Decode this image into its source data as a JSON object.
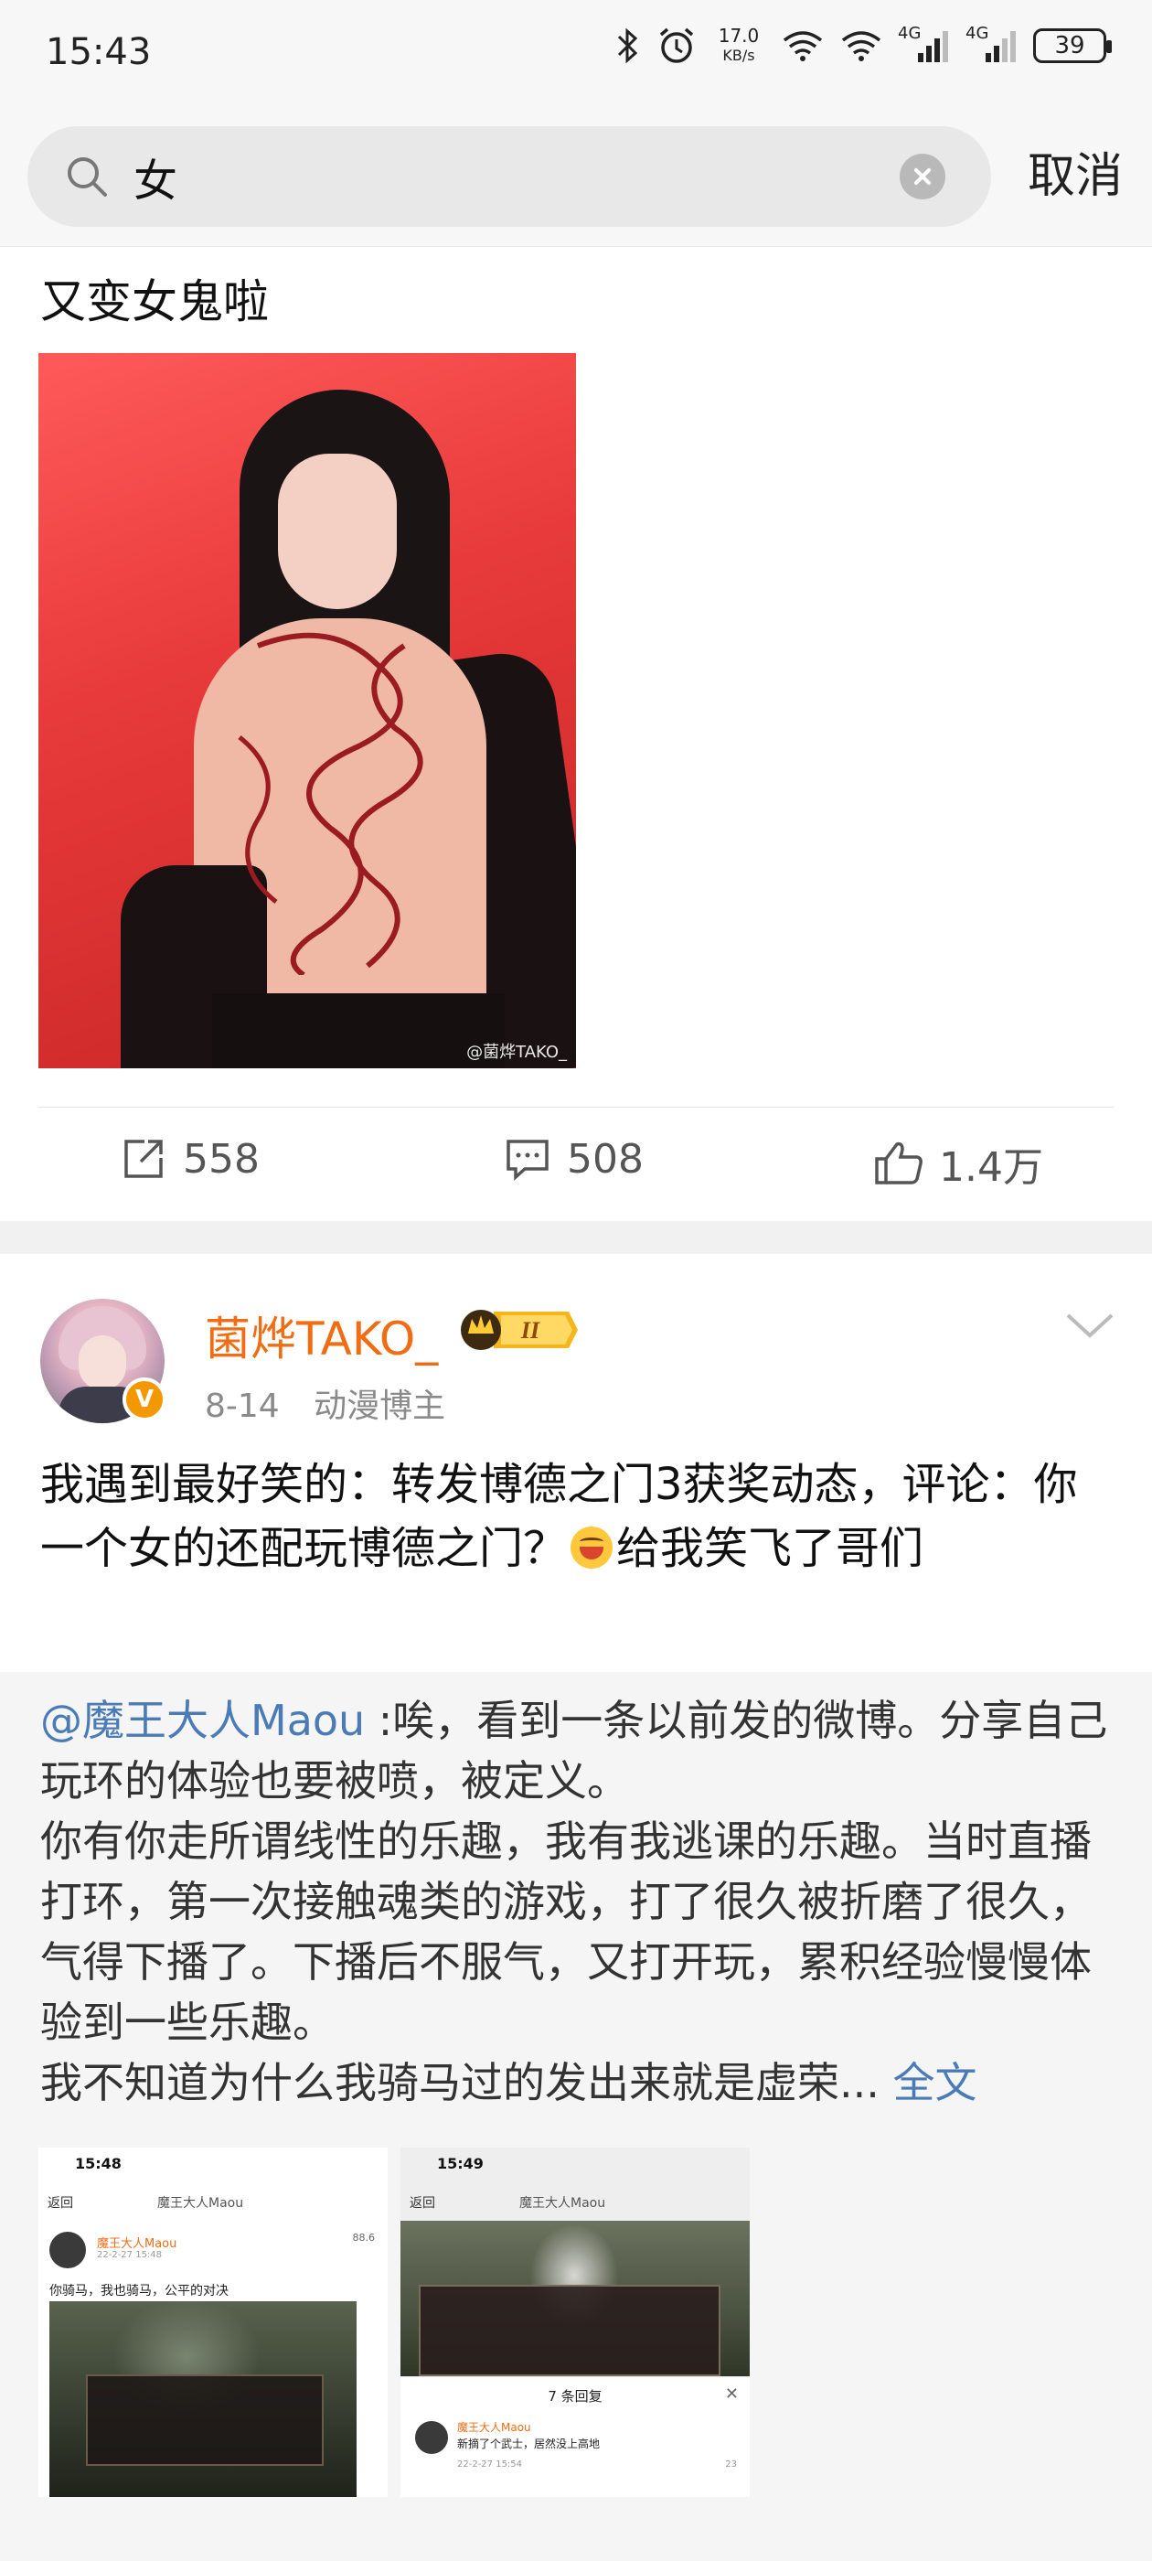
{
  "status_bar": {
    "time": "15:43",
    "net_speed_value": "17.0",
    "net_speed_unit": "KB/s",
    "sim1": "4G",
    "sim2": "4G",
    "battery": "39"
  },
  "search": {
    "query": "女",
    "cancel_label": "取消"
  },
  "post1": {
    "text": "又变女鬼啦",
    "watermark": "@菌烨TAKO_",
    "repost_count": "558",
    "comment_count": "508",
    "like_count": "1.4万"
  },
  "post2": {
    "username": "菌烨TAKO_",
    "date": "8-14",
    "tag": "动漫博主",
    "text_before_emoji": "我遇到最好笑的：转发博德之门3获奖动态，评论：你一个女的还配玩博德之门？",
    "text_after_emoji": "给我笑飞了哥们",
    "repost": {
      "mention": "@魔王大人Maou",
      "text": " :唉，看到一条以前发的微博。分享自己玩环的体验也要被喷，被定义。\n你有你走所谓线性的乐趣，我有我逃课的乐趣。当时直播打环，第一次接触魂类的游戏，打了很久被折磨了很久，气得下播了。下播后不服气，又打开玩，累积经验慢慢体验到一些乐趣。\n我不知道为什么我骑马过的发出来就是虚荣...",
      "read_more": "全文",
      "thumb1": {
        "time": "15:48",
        "back": "返回",
        "title": "魔王大人Maou",
        "user": "魔王大人Maou",
        "date": "22-2-27 15:48",
        "text": "你骑马，我也骑马，公平的对决",
        "score": "88.6"
      },
      "thumb2": {
        "time": "15:49",
        "back": "返回",
        "title": "魔王大人Maou",
        "popup_title": "7 条回复",
        "popup_user": "魔王大人Maou",
        "popup_text": "新摘了个武士，居然没上高地",
        "popup_date": "22-2-27 15:54",
        "popup_likes": "23"
      }
    }
  }
}
